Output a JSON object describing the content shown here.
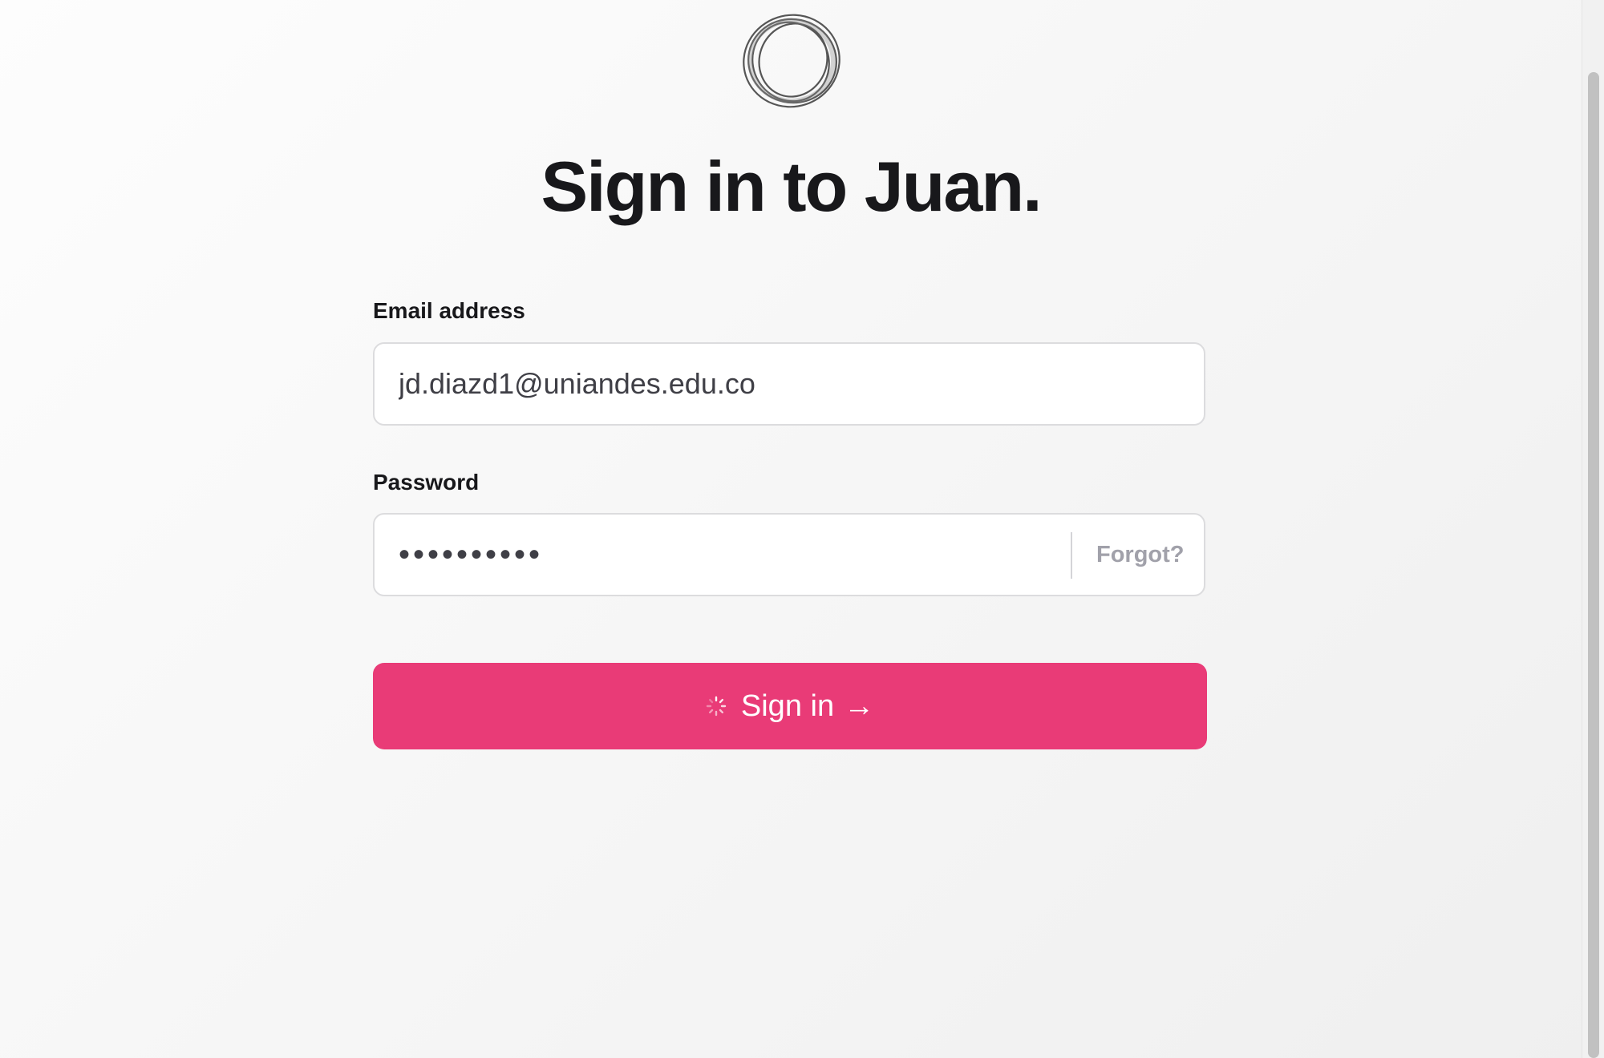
{
  "logo": {
    "icon": "ring-logo-icon"
  },
  "heading": {
    "title": "Sign in to Juan."
  },
  "form": {
    "email_label": "Email address",
    "email_value": "jd.diazd1@uniandes.edu.co",
    "password_label": "Password",
    "password_value": "••••••••••",
    "forgot_label": "Forgot?",
    "submit_label": "Sign in",
    "submit_arrow": "→",
    "submit_state_icon": "loading-spinner-icon"
  },
  "colors": {
    "accent": "#e93b77",
    "title": "#18181b",
    "muted": "#a1a1aa"
  }
}
